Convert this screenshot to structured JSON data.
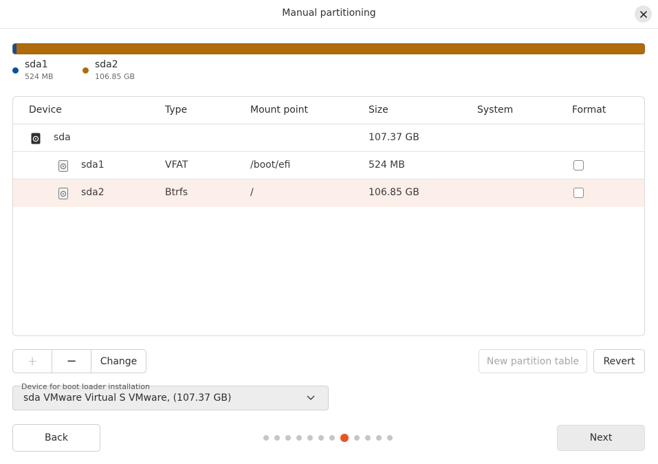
{
  "window": {
    "title": "Manual partitioning",
    "close_icon": "close-icon"
  },
  "usage": {
    "segments": [
      {
        "name": "sda1",
        "size": "524 MB",
        "color": "#0e4ea0",
        "fraction": 0.005
      },
      {
        "name": "sda2",
        "size": "106.85 GB",
        "color": "#b06b0c",
        "fraction": 0.995
      }
    ]
  },
  "table": {
    "headers": {
      "device": "Device",
      "type": "Type",
      "mount_point": "Mount point",
      "size": "Size",
      "system": "System",
      "format": "Format"
    },
    "rows": [
      {
        "device": "sda",
        "type": "",
        "mount_point": "",
        "size": "107.37 GB",
        "system": "",
        "format": null,
        "icon": "hard-disk-icon"
      },
      {
        "device": "sda1",
        "type": "VFAT",
        "mount_point": "/boot/efi",
        "size": "524 MB",
        "system": "",
        "format": false,
        "icon": "partition-icon"
      },
      {
        "device": "sda2",
        "type": "Btrfs",
        "mount_point": "/",
        "size": "106.85 GB",
        "system": "",
        "format": false,
        "icon": "partition-icon",
        "selected": true
      }
    ]
  },
  "toolbar": {
    "add_label": "+",
    "remove_label": "−",
    "change_label": "Change",
    "new_table_label": "New partition table",
    "revert_label": "Revert"
  },
  "bootloader": {
    "label": "Device for boot loader installation",
    "value": "sda VMware Virtual S VMware, (107.37 GB)"
  },
  "navigation": {
    "back_label": "Back",
    "next_label": "Next",
    "steps_total": 12,
    "current_step": 8
  },
  "colors": {
    "accent": "#e95420",
    "selected_row": "#fcefe9"
  }
}
